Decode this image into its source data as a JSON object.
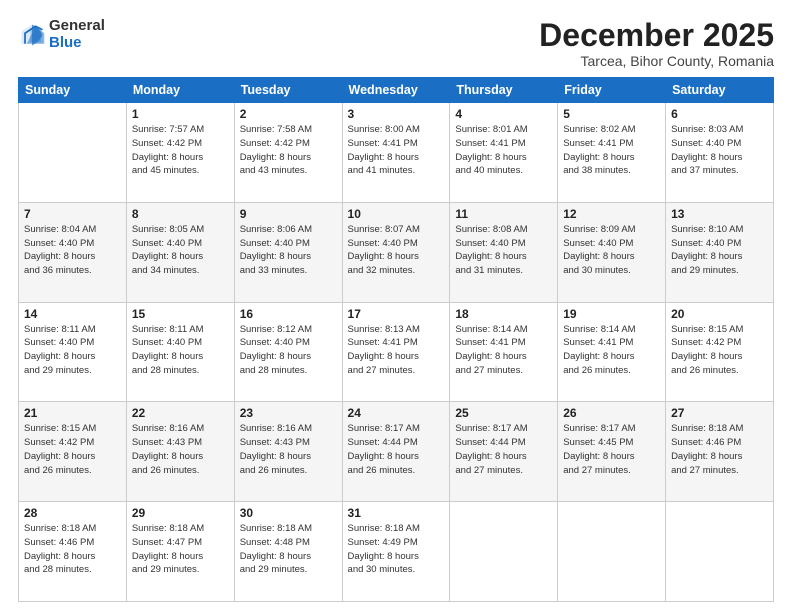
{
  "logo": {
    "general": "General",
    "blue": "Blue"
  },
  "header": {
    "month": "December 2025",
    "location": "Tarcea, Bihor County, Romania"
  },
  "weekdays": [
    "Sunday",
    "Monday",
    "Tuesday",
    "Wednesday",
    "Thursday",
    "Friday",
    "Saturday"
  ],
  "weeks": [
    [
      {
        "day": "",
        "sunrise": "",
        "sunset": "",
        "daylight": ""
      },
      {
        "day": "1",
        "sunrise": "Sunrise: 7:57 AM",
        "sunset": "Sunset: 4:42 PM",
        "daylight": "Daylight: 8 hours and 45 minutes."
      },
      {
        "day": "2",
        "sunrise": "Sunrise: 7:58 AM",
        "sunset": "Sunset: 4:42 PM",
        "daylight": "Daylight: 8 hours and 43 minutes."
      },
      {
        "day": "3",
        "sunrise": "Sunrise: 8:00 AM",
        "sunset": "Sunset: 4:41 PM",
        "daylight": "Daylight: 8 hours and 41 minutes."
      },
      {
        "day": "4",
        "sunrise": "Sunrise: 8:01 AM",
        "sunset": "Sunset: 4:41 PM",
        "daylight": "Daylight: 8 hours and 40 minutes."
      },
      {
        "day": "5",
        "sunrise": "Sunrise: 8:02 AM",
        "sunset": "Sunset: 4:41 PM",
        "daylight": "Daylight: 8 hours and 38 minutes."
      },
      {
        "day": "6",
        "sunrise": "Sunrise: 8:03 AM",
        "sunset": "Sunset: 4:40 PM",
        "daylight": "Daylight: 8 hours and 37 minutes."
      }
    ],
    [
      {
        "day": "7",
        "sunrise": "Sunrise: 8:04 AM",
        "sunset": "Sunset: 4:40 PM",
        "daylight": "Daylight: 8 hours and 36 minutes."
      },
      {
        "day": "8",
        "sunrise": "Sunrise: 8:05 AM",
        "sunset": "Sunset: 4:40 PM",
        "daylight": "Daylight: 8 hours and 34 minutes."
      },
      {
        "day": "9",
        "sunrise": "Sunrise: 8:06 AM",
        "sunset": "Sunset: 4:40 PM",
        "daylight": "Daylight: 8 hours and 33 minutes."
      },
      {
        "day": "10",
        "sunrise": "Sunrise: 8:07 AM",
        "sunset": "Sunset: 4:40 PM",
        "daylight": "Daylight: 8 hours and 32 minutes."
      },
      {
        "day": "11",
        "sunrise": "Sunrise: 8:08 AM",
        "sunset": "Sunset: 4:40 PM",
        "daylight": "Daylight: 8 hours and 31 minutes."
      },
      {
        "day": "12",
        "sunrise": "Sunrise: 8:09 AM",
        "sunset": "Sunset: 4:40 PM",
        "daylight": "Daylight: 8 hours and 30 minutes."
      },
      {
        "day": "13",
        "sunrise": "Sunrise: 8:10 AM",
        "sunset": "Sunset: 4:40 PM",
        "daylight": "Daylight: 8 hours and 29 minutes."
      }
    ],
    [
      {
        "day": "14",
        "sunrise": "Sunrise: 8:11 AM",
        "sunset": "Sunset: 4:40 PM",
        "daylight": "Daylight: 8 hours and 29 minutes."
      },
      {
        "day": "15",
        "sunrise": "Sunrise: 8:11 AM",
        "sunset": "Sunset: 4:40 PM",
        "daylight": "Daylight: 8 hours and 28 minutes."
      },
      {
        "day": "16",
        "sunrise": "Sunrise: 8:12 AM",
        "sunset": "Sunset: 4:40 PM",
        "daylight": "Daylight: 8 hours and 28 minutes."
      },
      {
        "day": "17",
        "sunrise": "Sunrise: 8:13 AM",
        "sunset": "Sunset: 4:41 PM",
        "daylight": "Daylight: 8 hours and 27 minutes."
      },
      {
        "day": "18",
        "sunrise": "Sunrise: 8:14 AM",
        "sunset": "Sunset: 4:41 PM",
        "daylight": "Daylight: 8 hours and 27 minutes."
      },
      {
        "day": "19",
        "sunrise": "Sunrise: 8:14 AM",
        "sunset": "Sunset: 4:41 PM",
        "daylight": "Daylight: 8 hours and 26 minutes."
      },
      {
        "day": "20",
        "sunrise": "Sunrise: 8:15 AM",
        "sunset": "Sunset: 4:42 PM",
        "daylight": "Daylight: 8 hours and 26 minutes."
      }
    ],
    [
      {
        "day": "21",
        "sunrise": "Sunrise: 8:15 AM",
        "sunset": "Sunset: 4:42 PM",
        "daylight": "Daylight: 8 hours and 26 minutes."
      },
      {
        "day": "22",
        "sunrise": "Sunrise: 8:16 AM",
        "sunset": "Sunset: 4:43 PM",
        "daylight": "Daylight: 8 hours and 26 minutes."
      },
      {
        "day": "23",
        "sunrise": "Sunrise: 8:16 AM",
        "sunset": "Sunset: 4:43 PM",
        "daylight": "Daylight: 8 hours and 26 minutes."
      },
      {
        "day": "24",
        "sunrise": "Sunrise: 8:17 AM",
        "sunset": "Sunset: 4:44 PM",
        "daylight": "Daylight: 8 hours and 26 minutes."
      },
      {
        "day": "25",
        "sunrise": "Sunrise: 8:17 AM",
        "sunset": "Sunset: 4:44 PM",
        "daylight": "Daylight: 8 hours and 27 minutes."
      },
      {
        "day": "26",
        "sunrise": "Sunrise: 8:17 AM",
        "sunset": "Sunset: 4:45 PM",
        "daylight": "Daylight: 8 hours and 27 minutes."
      },
      {
        "day": "27",
        "sunrise": "Sunrise: 8:18 AM",
        "sunset": "Sunset: 4:46 PM",
        "daylight": "Daylight: 8 hours and 27 minutes."
      }
    ],
    [
      {
        "day": "28",
        "sunrise": "Sunrise: 8:18 AM",
        "sunset": "Sunset: 4:46 PM",
        "daylight": "Daylight: 8 hours and 28 minutes."
      },
      {
        "day": "29",
        "sunrise": "Sunrise: 8:18 AM",
        "sunset": "Sunset: 4:47 PM",
        "daylight": "Daylight: 8 hours and 29 minutes."
      },
      {
        "day": "30",
        "sunrise": "Sunrise: 8:18 AM",
        "sunset": "Sunset: 4:48 PM",
        "daylight": "Daylight: 8 hours and 29 minutes."
      },
      {
        "day": "31",
        "sunrise": "Sunrise: 8:18 AM",
        "sunset": "Sunset: 4:49 PM",
        "daylight": "Daylight: 8 hours and 30 minutes."
      },
      {
        "day": "",
        "sunrise": "",
        "sunset": "",
        "daylight": ""
      },
      {
        "day": "",
        "sunrise": "",
        "sunset": "",
        "daylight": ""
      },
      {
        "day": "",
        "sunrise": "",
        "sunset": "",
        "daylight": ""
      }
    ]
  ]
}
